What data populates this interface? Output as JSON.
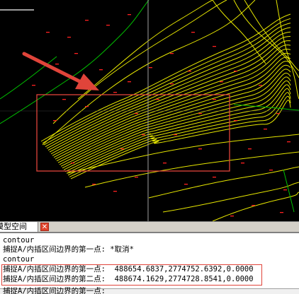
{
  "tabs": {
    "model_label": "模型空间",
    "close_glyph": "✕"
  },
  "command_history": [
    "contour",
    "捕捉A/内插区间边界的第一点: *取消*",
    "contour",
    "捕捉A/内插区间边界的第一点:  488654.6837,2774752.6392,0.0000",
    "捕捉A/内插区间边界的第二点:  488674.1629,2774728.8541,0.0000",
    "捕捉A/内插区间边界的第一点:"
  ],
  "colors": {
    "contour": "#e6e600",
    "ridge": "#00c000",
    "annotation": "#e0443a",
    "crosshair": "#c8c8c8",
    "elevation_mark": "#ff2020"
  },
  "icons": {
    "tab_close": "close-icon",
    "arrow": "arrow-icon"
  }
}
